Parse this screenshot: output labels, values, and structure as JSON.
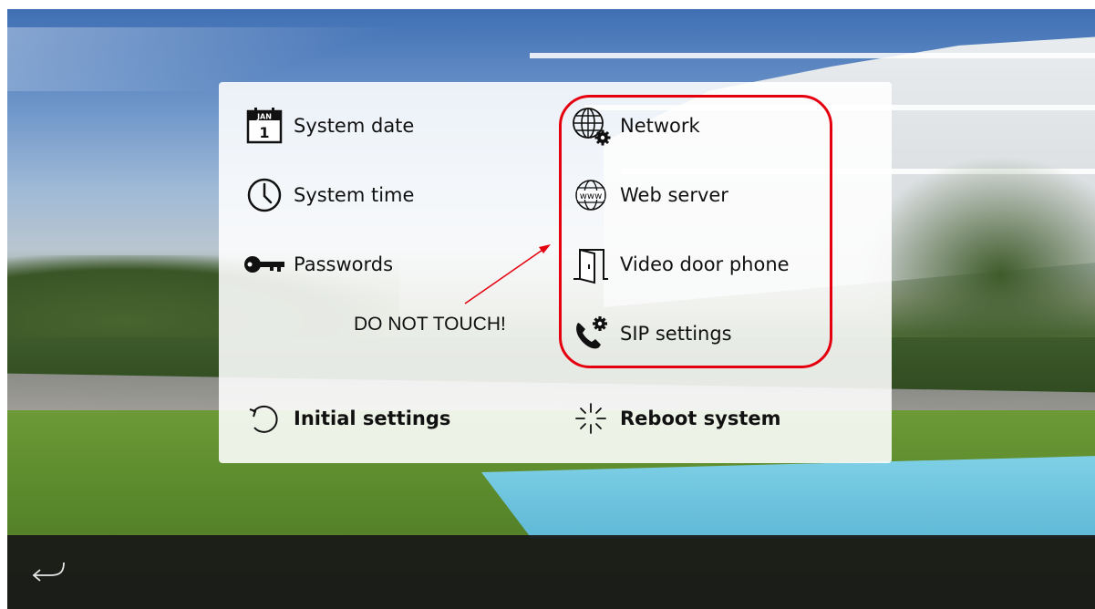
{
  "settings_panel": {
    "left_column": [
      {
        "label": "System date",
        "icon": "calendar-icon",
        "calendar_month": "JAN",
        "calendar_day": "1"
      },
      {
        "label": "System time",
        "icon": "clock-icon"
      },
      {
        "label": "Passwords",
        "icon": "key-icon"
      }
    ],
    "right_column": [
      {
        "label": "Network",
        "icon": "globe-gear-icon"
      },
      {
        "label": "Web server",
        "icon": "globe-www-icon",
        "icon_text": "www"
      },
      {
        "label": "Video door phone",
        "icon": "door-icon"
      },
      {
        "label": "SIP settings",
        "icon": "phone-gear-icon"
      }
    ],
    "bottom_row": [
      {
        "label": "Initial settings",
        "icon": "reset-icon"
      },
      {
        "label": "Reboot system",
        "icon": "reboot-icon"
      }
    ]
  },
  "annotation": {
    "text": "DO NOT TOUCH!",
    "color": "#e5000f"
  },
  "bottom_bar": {
    "back_icon": "back-arrow-icon"
  }
}
